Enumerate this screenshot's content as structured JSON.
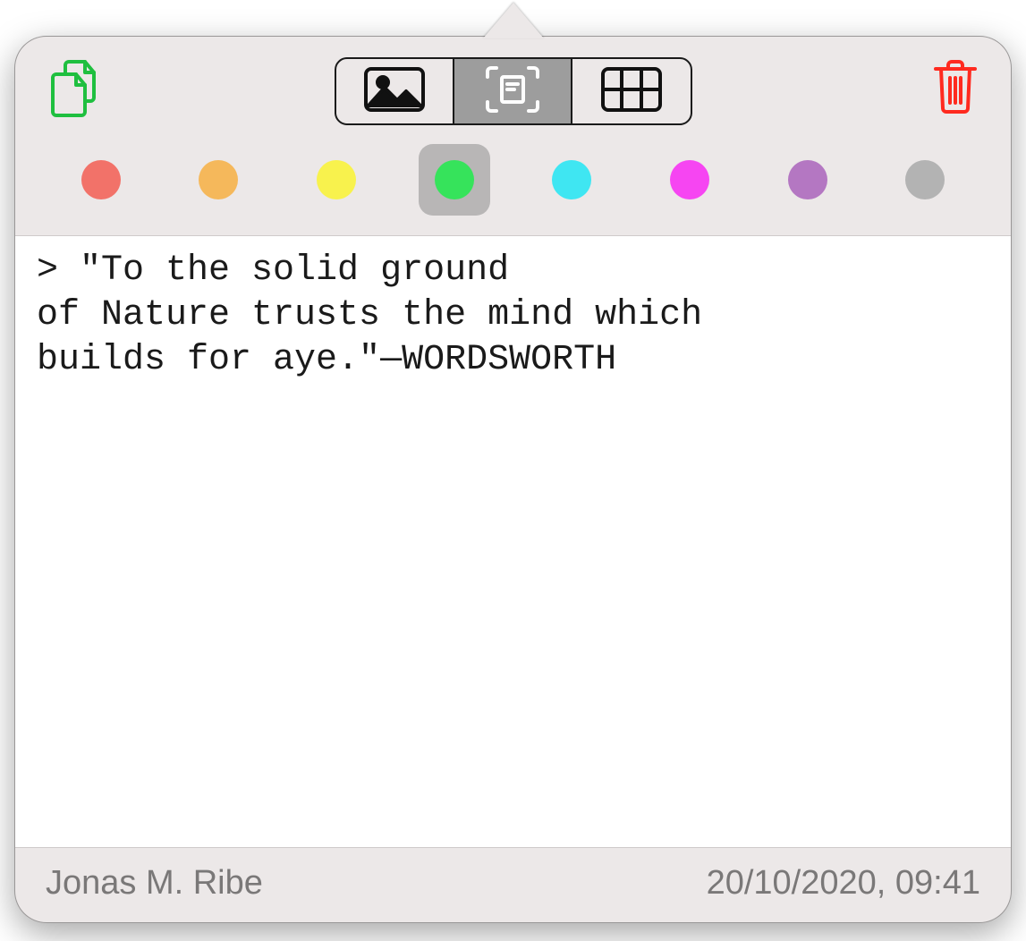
{
  "toolbar": {
    "copy_label": "copy",
    "trash_label": "delete",
    "segments": {
      "image": "image-mode",
      "text": "text-capture-mode",
      "table": "table-mode",
      "active": "text"
    }
  },
  "colors": {
    "options": [
      {
        "name": "red",
        "hex": "#f27269"
      },
      {
        "name": "orange",
        "hex": "#f5b85b"
      },
      {
        "name": "yellow",
        "hex": "#f8f24d"
      },
      {
        "name": "green",
        "hex": "#36e35b"
      },
      {
        "name": "cyan",
        "hex": "#3fe6f2"
      },
      {
        "name": "magenta",
        "hex": "#f645f2"
      },
      {
        "name": "purple",
        "hex": "#b477c2"
      },
      {
        "name": "gray",
        "hex": "#b3b3b3"
      }
    ],
    "selected": "green"
  },
  "note": {
    "text": "> \"To the solid ground\nof Nature trusts the mind which\nbuilds for aye.\"—WORDSWORTH"
  },
  "footer": {
    "author": "Jonas M. Ribe",
    "timestamp": "20/10/2020, 09:41"
  }
}
